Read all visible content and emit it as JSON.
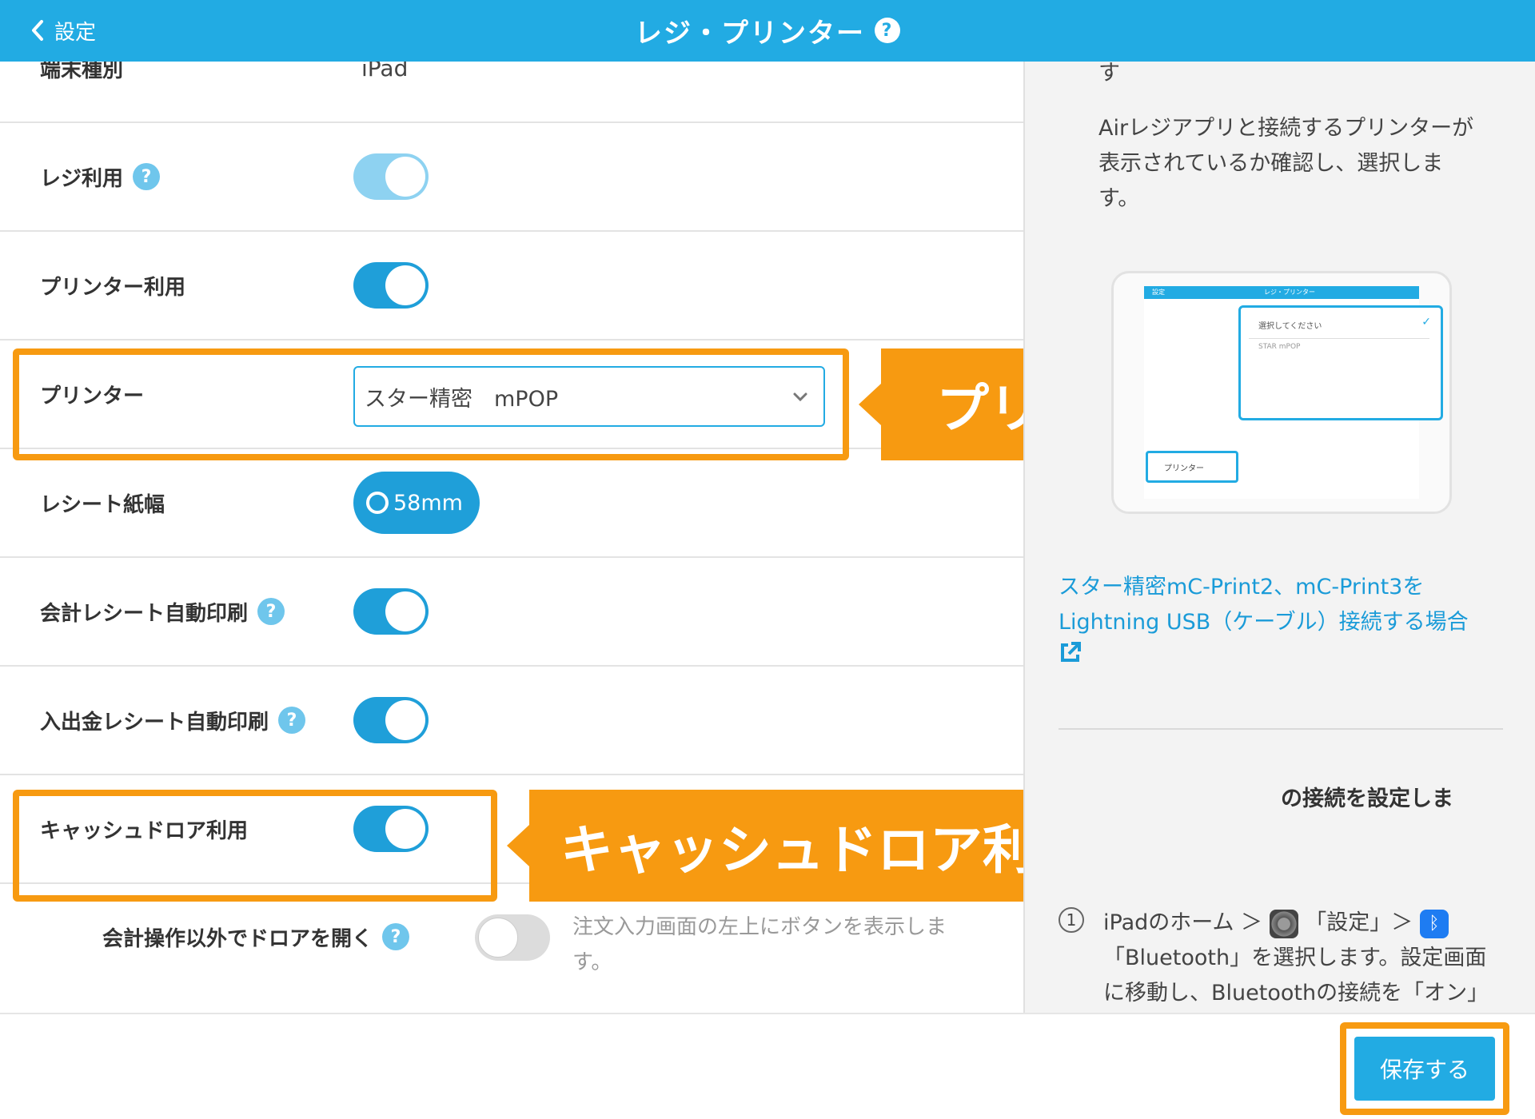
{
  "header": {
    "back_label": "設定",
    "title": "レジ・プリンター",
    "help_glyph": "?"
  },
  "settings": {
    "device_type": {
      "label": "端末種別",
      "value": "iPad"
    },
    "register_use": {
      "label": "レジ利用",
      "state": "on-disabled"
    },
    "printer_use": {
      "label": "プリンター利用",
      "state": "on"
    },
    "printer": {
      "label": "プリンター",
      "value": "スター精密　mPOP"
    },
    "receipt_width": {
      "label": "レシート紙幅",
      "option": "58mm"
    },
    "auto_print_receipt": {
      "label": "会計レシート自動印刷",
      "state": "on"
    },
    "auto_print_cash": {
      "label": "入出金レシート自動印刷",
      "state": "on"
    },
    "cash_drawer": {
      "label": "キャッシュドロア利用",
      "state": "on"
    },
    "open_drawer": {
      "label": "会計操作以外でドロアを開く",
      "state": "off",
      "description": "注文入力画面の左上にボタンを表示します。"
    }
  },
  "callouts": {
    "printer_select": "プリンター選択",
    "cash_drawer_on": "キャッシュドロア利用：オン"
  },
  "side_panel": {
    "top_fragment": "す",
    "intro": "Airレジアプリと接続するプリンターが表示されているか確認し、選択します。",
    "thumb": {
      "back": "設定",
      "title": "レジ・プリンター",
      "popup_item": "選択してください",
      "popup_item2": "STAR mPOP",
      "row_label": "プリンター"
    },
    "link_text": "スター精密mC-Print2、mC-Print3をLightning USB（ケーブル）接続する場合",
    "step_title": "の接続を設定しま",
    "step1_num": "1",
    "step1_a": "iPadのホーム ＞",
    "step1_b": "「設定」＞",
    "step1_c": "「Bluetooth」を選択します。設定画面に移動し、Bluetoothの接続を「オン」に"
  },
  "footer": {
    "save_label": "保存する"
  },
  "colors": {
    "brand": "#22ABE3",
    "toggle_on": "#1F9FD9",
    "highlight": "#F79A11",
    "link": "#1A9BD8"
  }
}
